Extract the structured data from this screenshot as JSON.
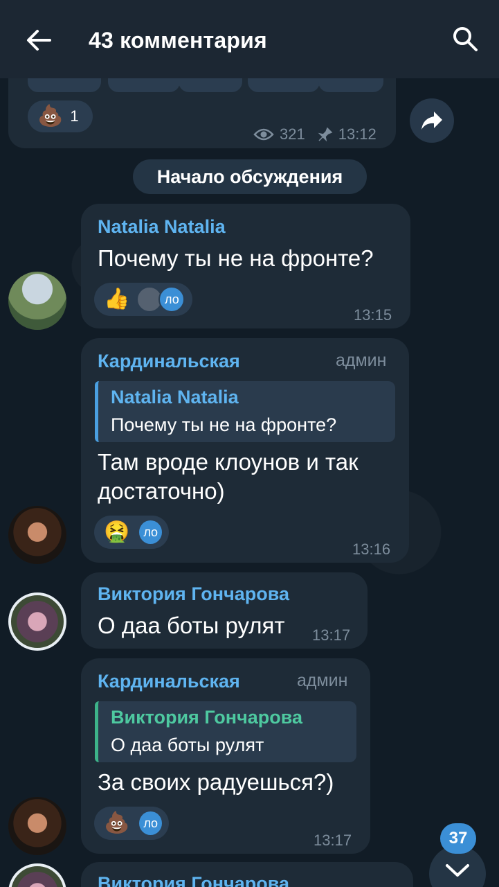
{
  "header": {
    "title": "43 комментария"
  },
  "post": {
    "reaction_count": "1",
    "views": "321",
    "time": "13:12"
  },
  "service_message": "Начало обсуждения",
  "messages": [
    {
      "author": "Natalia Natalia",
      "text": "Почему ты не на фронте?",
      "reaction_label": "ло",
      "time": "13:15"
    },
    {
      "author": "Кардинальская",
      "role": "админ",
      "reply_author": "Natalia Natalia",
      "reply_text": "Почему ты не на фронте?",
      "text_line1": "Там вроде клоунов и так",
      "text_line2": "достаточно)",
      "reaction_label": "ло",
      "time": "13:16"
    },
    {
      "author": "Виктория Гончарова",
      "text": "О даа боты рулят",
      "time": "13:17"
    },
    {
      "author": "Кардинальская",
      "role": "админ",
      "reply_author": "Виктория Гончарова",
      "reply_text": "О даа боты рулят",
      "text": "За своих радуешься?)",
      "reaction_label": "ло",
      "time": "13:17"
    },
    {
      "author": "Виктория Гончарова"
    }
  ],
  "unread_count": "37",
  "colors": {
    "header_bg": "#1c2733",
    "bubble_bg": "#1e2b37",
    "name_blue": "#5fb4f0",
    "name_green": "#4ec9a0",
    "accent": "#3b8fd6"
  }
}
